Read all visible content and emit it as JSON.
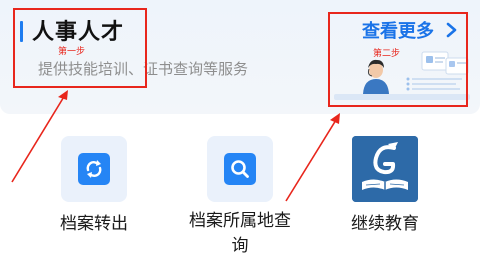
{
  "banner": {
    "title": "人事人才",
    "description": "提供技能培训、证书查询等服务",
    "view_more": "查看更多",
    "chevron_icon": "chevron-right-icon",
    "illustration_icon": "customer-service-illustration"
  },
  "annotations": {
    "step1": "第一步",
    "step2": "第二步",
    "color": "#e8261c"
  },
  "services": [
    {
      "label": "档案转出",
      "icon": "transfer-icon"
    },
    {
      "label": "档案所属地查询",
      "icon": "search-icon"
    },
    {
      "label": "继续教育",
      "icon": "education-book-icon"
    }
  ],
  "colors": {
    "accent": "#1e7cf0",
    "link": "#1a73e8",
    "tile_bg": "#eaf1fb",
    "icon_bg": "#2585f5",
    "education_bg": "#2d6aa8"
  }
}
